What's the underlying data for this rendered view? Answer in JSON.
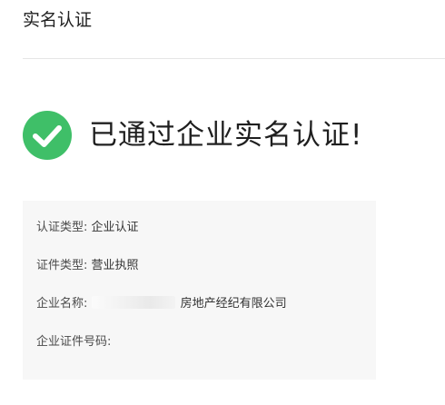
{
  "header": {
    "title": "实名认证"
  },
  "status": {
    "icon": "check-circle-icon",
    "color": "#3fbf68",
    "message": "已通过企业实名认证!"
  },
  "details": {
    "cert_type": {
      "label": "认证类型:",
      "value": "企业认证"
    },
    "doc_type": {
      "label": "证件类型:",
      "value": "营业执照"
    },
    "company_name": {
      "label": "企业名称:",
      "value_visible": "房地产经纪有限公司"
    },
    "company_id": {
      "label": "企业证件号码:",
      "value": ""
    }
  }
}
